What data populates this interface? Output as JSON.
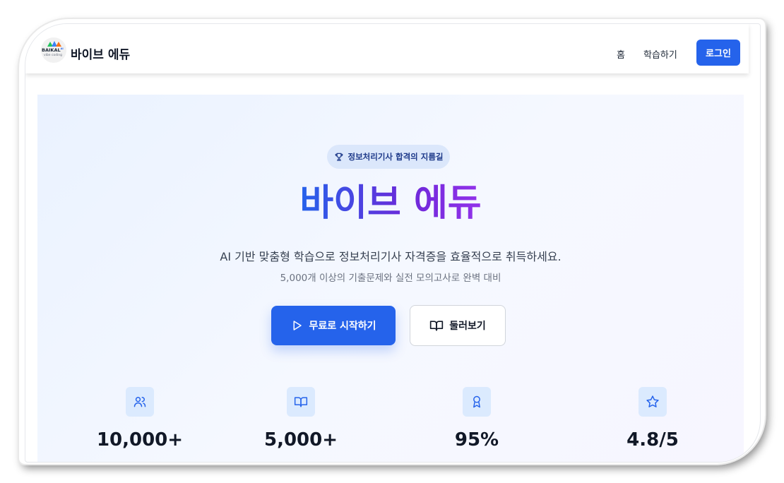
{
  "header": {
    "logo": {
      "word": "BAIKAL",
      "sup": "AI",
      "sub": "vibe coding"
    },
    "brand": "바이브 에듀",
    "nav": {
      "home": "홈",
      "learn": "학습하기"
    },
    "login_label": "로그인"
  },
  "hero": {
    "badge": "정보처리기사 합격의 지름길",
    "title": "바이브 에듀",
    "tagline": "AI 기반 맞춤형 학습으로 정보처리기사 자격증을 효율적으로 취득하세요.",
    "subtag": "5,000개 이상의 기출문제와 실전 모의고사로 완벽 대비",
    "primary_button": "무료로 시작하기",
    "secondary_button": "둘러보기"
  },
  "stats": [
    {
      "icon": "users-icon",
      "value": "10,000+"
    },
    {
      "icon": "book-icon",
      "value": "5,000+"
    },
    {
      "icon": "award-icon",
      "value": "95%"
    },
    {
      "icon": "star-icon",
      "value": "4.8/5"
    }
  ],
  "colors": {
    "accent": "#2563eb",
    "gradient_end": "#9333ea",
    "icon_box": "#dbeafe"
  }
}
